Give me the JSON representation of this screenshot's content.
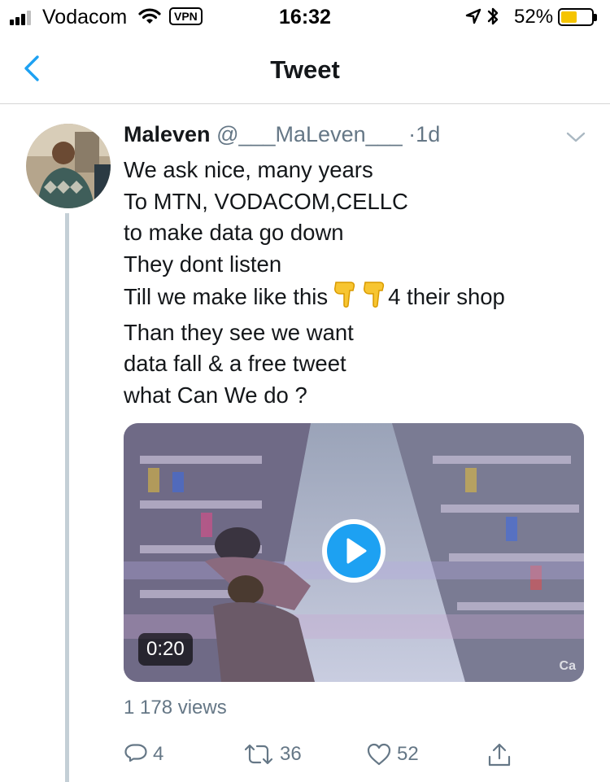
{
  "status_bar": {
    "carrier": "Vodacom",
    "vpn_label": "VPN",
    "time": "16:32",
    "battery_percent": "52%",
    "battery_level": 0.52,
    "battery_color": "#f5c400",
    "icons": [
      "signal-icon",
      "wifi-icon",
      "location-icon",
      "bluetooth-icon",
      "battery-icon"
    ]
  },
  "nav": {
    "back_icon": "chevron-left-icon",
    "title": "Tweet"
  },
  "tweet": {
    "display_name": "Maleven",
    "handle": "@___MaLeven___",
    "separator": "·",
    "time_ago": "1d",
    "text_lines": [
      "We ask nice, many years",
      "To MTN, VODACOM,CELLC",
      "to make data go down",
      "They dont listen",
      "Till we make like this",
      "4 their shop",
      "Than they see we want",
      "data fall & a free tweet",
      "what Can We do ?"
    ],
    "emoji": "pointing-down-hand-emoji",
    "video": {
      "duration": "0:20",
      "watermark": "Ca"
    },
    "views": "1 178 views",
    "actions": {
      "reply_count": "4",
      "retweet_count": "36",
      "like_count": "52"
    }
  },
  "colors": {
    "accent": "#1da1f2",
    "secondary_text": "#657786",
    "primary_text": "#14171a",
    "thread_line": "#c4cfd6"
  }
}
